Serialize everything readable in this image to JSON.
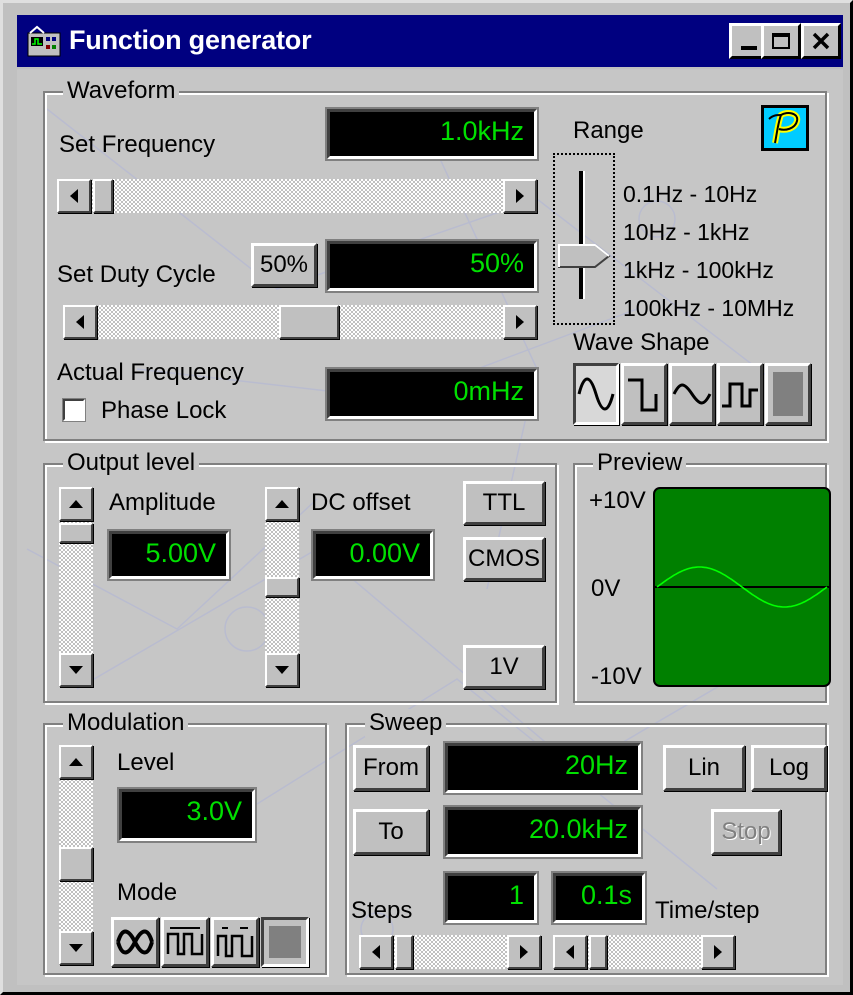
{
  "window": {
    "title": "Function generator"
  },
  "waveform": {
    "legend": "Waveform",
    "set_frequency_label": "Set Frequency",
    "frequency_value": "1.0kHz",
    "frequency_slider": 0.02,
    "set_duty_cycle_label": "Set Duty Cycle",
    "duty_50_button": "50%",
    "duty_value": "50%",
    "duty_slider": 0.5,
    "actual_frequency_label": "Actual Frequency",
    "actual_frequency_value": "0mHz",
    "phase_lock_label": "Phase Lock",
    "phase_lock_checked": false,
    "range_label": "Range",
    "range_options": [
      "0.1Hz - 10Hz",
      "10Hz - 1kHz",
      "1kHz - 100kHz",
      "100kHz - 10MHz"
    ],
    "range_selected": "1kHz - 100kHz",
    "wave_shape_label": "Wave Shape",
    "wave_shapes": [
      "sine-wave-icon",
      "square-wave-icon",
      "triangle-wave-icon",
      "pulse-wave-icon",
      "blank-wave-icon"
    ],
    "wave_shape_selected": "sine-wave-icon",
    "logo_icon": "p-logo-icon"
  },
  "output_level": {
    "legend": "Output level",
    "amplitude_label": "Amplitude",
    "amplitude_value": "5.00V",
    "dc_offset_label": "DC offset",
    "dc_offset_value": "0.00V",
    "ttl_button": "TTL",
    "cmos_button": "CMOS",
    "one_v_button": "1V"
  },
  "preview": {
    "legend": "Preview",
    "y_top_label": "+10V",
    "y_mid_label": "0V",
    "y_bottom_label": "-10V",
    "plot_bg_color": "#008000",
    "trace_color": "#00ff00"
  },
  "modulation": {
    "legend": "Modulation",
    "level_label": "Level",
    "level_value": "3.0V",
    "mode_label": "Mode",
    "mode_icons": [
      "am-mode-icon",
      "fm-mode-icon",
      "fsk-mode-icon",
      "off-mode-icon"
    ]
  },
  "sweep": {
    "legend": "Sweep",
    "from_button": "From",
    "from_value": "20Hz",
    "to_button": "To",
    "to_value": "20.0kHz",
    "lin_button": "Lin",
    "log_button": "Log",
    "stop_button": "Stop",
    "steps_label": "Steps",
    "steps_value": "1",
    "time_step_value": "0.1s",
    "time_step_label": "Time/step"
  },
  "colors": {
    "title_bar": "#000080",
    "lcd_bg": "#000000",
    "lcd_text": "#00e000",
    "logo_bg": "#00ccff",
    "logo_fg": "#ffff00"
  }
}
